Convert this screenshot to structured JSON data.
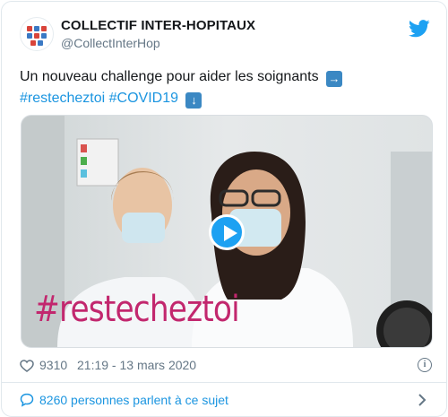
{
  "account": {
    "name": "COLLECTIF INTER-HOPITAUX",
    "handle": "@CollectInterHop"
  },
  "tweet": {
    "text_main": "Un nouveau challenge pour aider les soignants",
    "arrow_right_emoji": "➡️",
    "hashtag_1": "#restecheztoi",
    "hashtag_2": "#COVID19",
    "arrow_down_emoji": "⬇️"
  },
  "media": {
    "overlay_text": "#restecheztoi",
    "play_icon": "play-icon"
  },
  "meta": {
    "likes": "9310",
    "timestamp": "21:19 - 13 mars 2020"
  },
  "footer": {
    "conversation_label": "8260 personnes parlent à ce sujet"
  },
  "colors": {
    "accent": "#1da1f2",
    "link": "#1b95e0",
    "muted": "#657786",
    "overlay": "#c2276e"
  }
}
